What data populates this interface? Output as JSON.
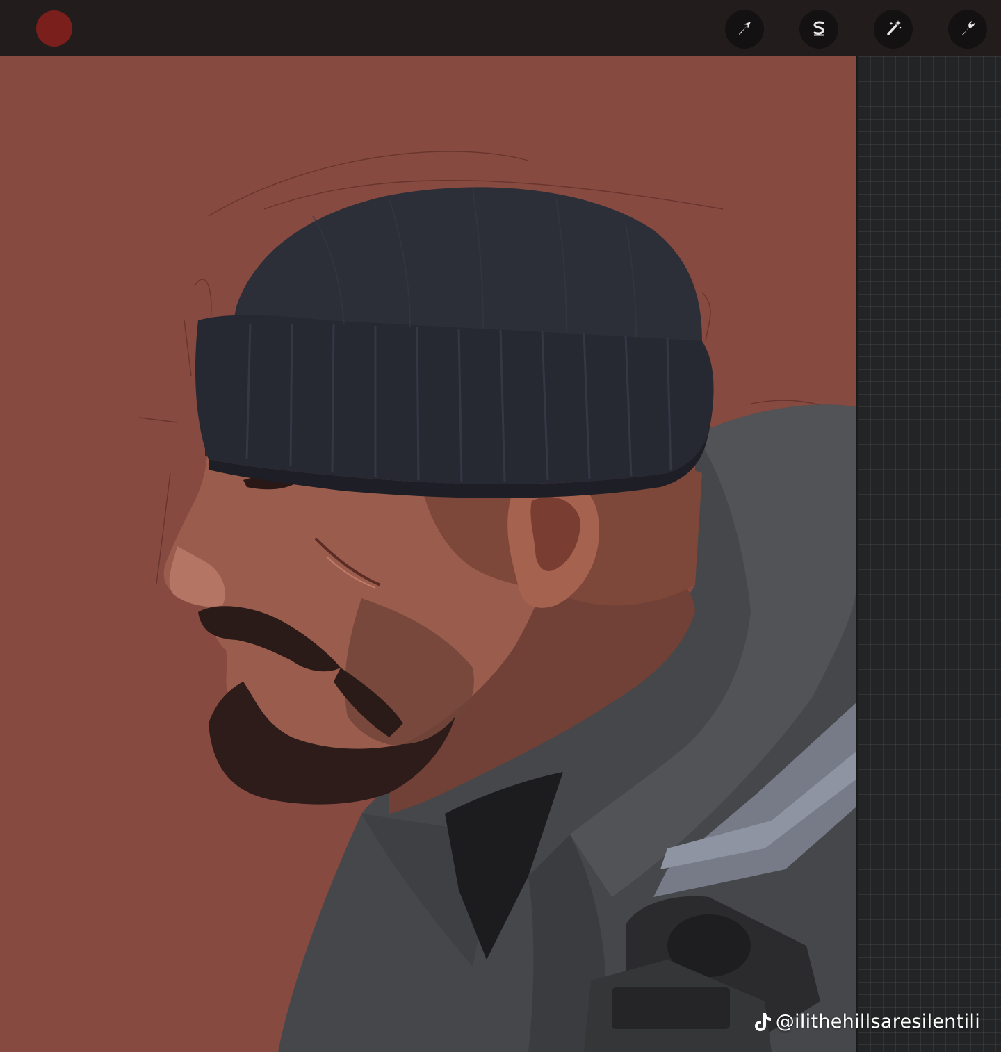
{
  "toolbar": {
    "current_color": "#7a1f1c",
    "tools": [
      {
        "name": "transform",
        "icon": "arrow-cursor-icon"
      },
      {
        "name": "selection",
        "icon": "selection-s-icon"
      },
      {
        "name": "adjustments",
        "icon": "magic-wand-icon"
      },
      {
        "name": "actions",
        "icon": "wrench-icon"
      }
    ]
  },
  "canvas": {
    "background_color": "#874a40",
    "subject": "painted-portrait"
  },
  "watermark": {
    "icon": "tiktok-note-icon",
    "handle": "@ilithehillsaresilentili"
  }
}
